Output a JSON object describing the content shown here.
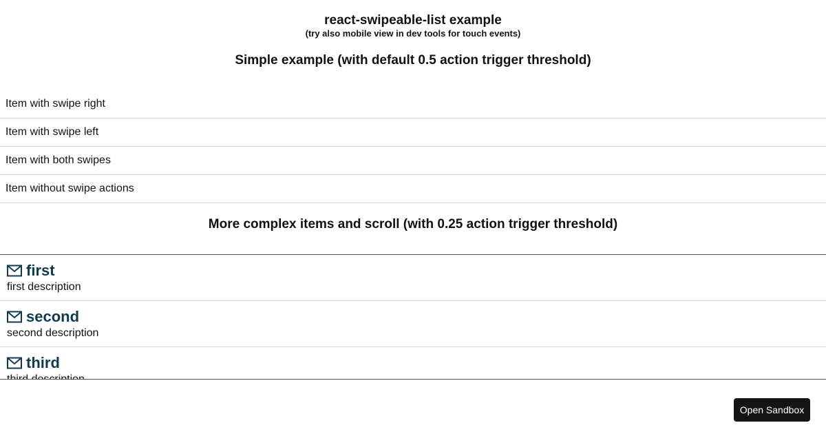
{
  "header": {
    "title": "react-swipeable-list example",
    "subtitle": "(try also mobile view in dev tools for touch events)"
  },
  "simple_section": {
    "heading": "Simple example (with default 0.5 action trigger threshold)",
    "items": [
      {
        "label": "Item with swipe right"
      },
      {
        "label": "Item with swipe left"
      },
      {
        "label": "Item with both swipes"
      },
      {
        "label": "Item without swipe actions"
      }
    ]
  },
  "complex_section": {
    "heading": "More complex items and scroll (with 0.25 action trigger threshold)",
    "items": [
      {
        "icon": "mail-icon",
        "name": "first",
        "description": "first description"
      },
      {
        "icon": "mail-icon",
        "name": "second",
        "description": "second description"
      },
      {
        "icon": "mail-icon",
        "name": "third",
        "description": "third description"
      }
    ]
  },
  "sandbox": {
    "label": "Open Sandbox"
  },
  "colors": {
    "item_name": "#0f3b4f",
    "sandbox_bg": "#151515"
  }
}
